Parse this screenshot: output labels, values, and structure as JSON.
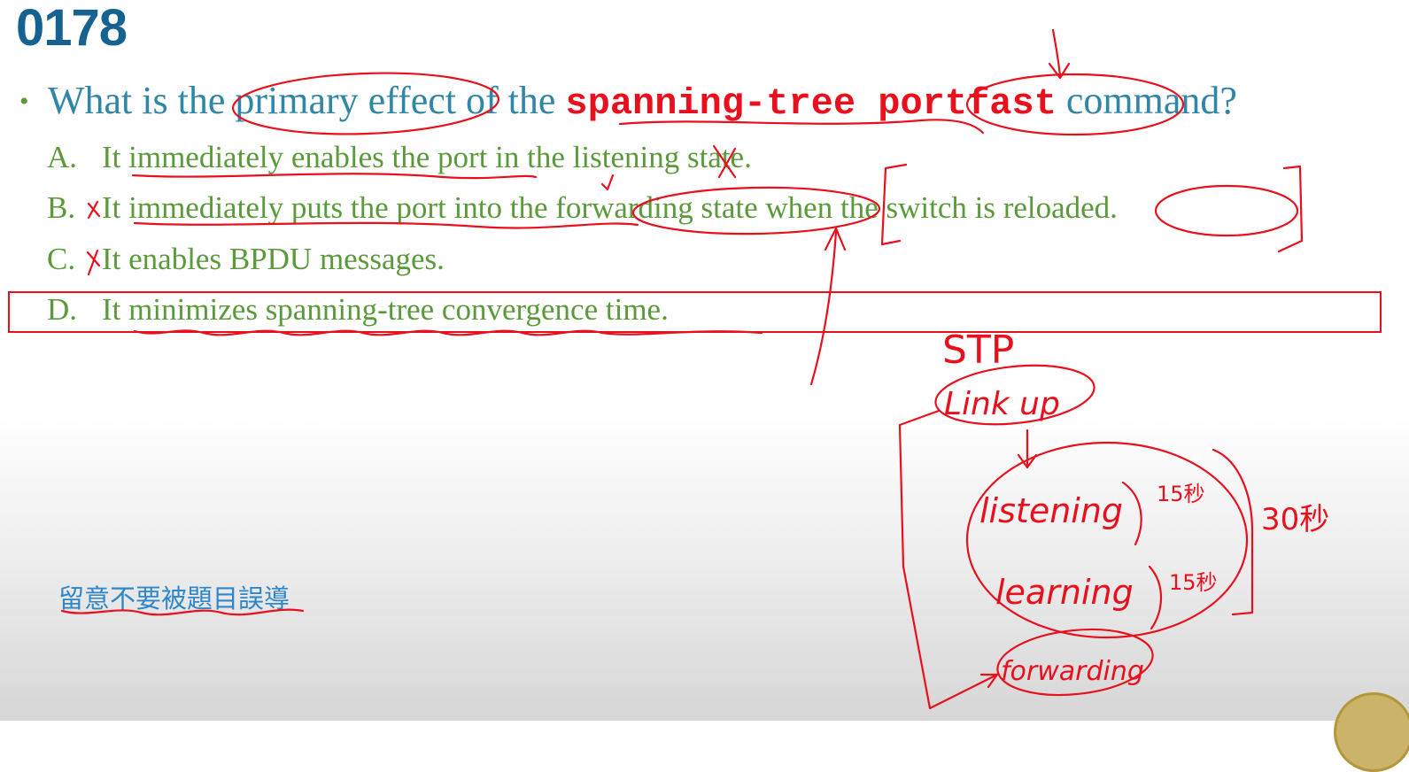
{
  "slide": {
    "number": "0178"
  },
  "question": {
    "bullet": "•",
    "text_before": "What is the primary effect of the ",
    "command": "spanning-tree portfast",
    "text_after": " command?"
  },
  "options": [
    {
      "letter": "A.",
      "text": "It immediately enables the port in the listening state."
    },
    {
      "letter": "B.",
      "text": "It immediately puts the port into the forwarding state when the switch is reloaded."
    },
    {
      "letter": "C.",
      "text": "It enables BPDU messages."
    },
    {
      "letter": "D.",
      "text": "It minimizes spanning-tree convergence time."
    }
  ],
  "note": "留意不要被題目誤導",
  "annotations": {
    "stp": "STP",
    "link_up": "Link up",
    "listening": "listening",
    "learning": "learning",
    "forwarding": "forwarding",
    "time_15_a": "15秒",
    "time_15_b": "15秒",
    "time_30": "30秒"
  },
  "colors": {
    "title": "#15618f",
    "question": "#2f86a6",
    "options": "#5a9a3b",
    "command": "#e8101c",
    "ink": "#e8101c",
    "note": "#2f86c9"
  }
}
